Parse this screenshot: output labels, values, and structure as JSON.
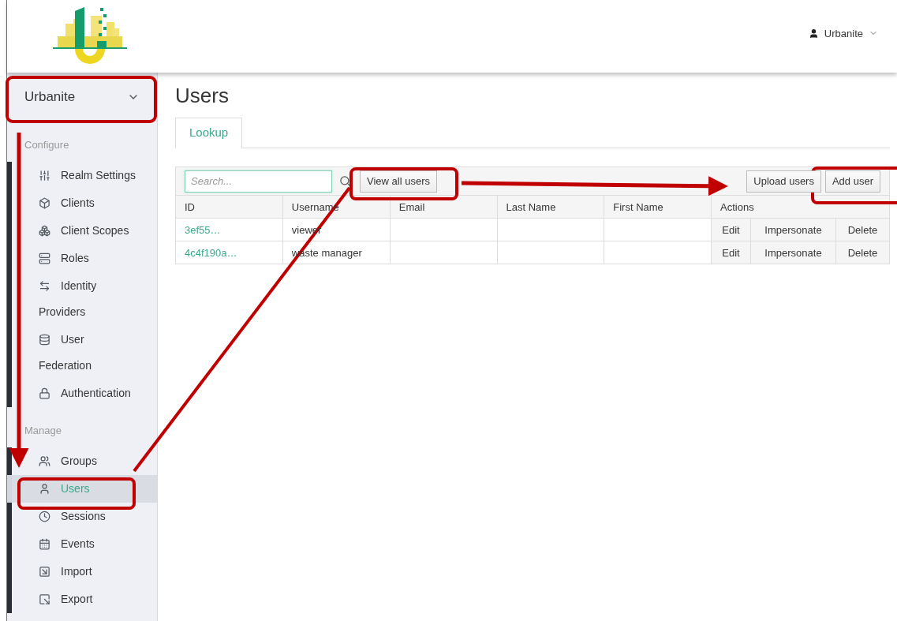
{
  "header": {
    "user": "Urbanite"
  },
  "sidebar": {
    "realm": "Urbanite",
    "sections": [
      {
        "title": "Configure",
        "items": [
          {
            "label": "Realm Settings",
            "selected": false
          },
          {
            "label": "Clients",
            "selected": false
          },
          {
            "label": "Client Scopes",
            "selected": false
          },
          {
            "label": "Roles",
            "selected": false
          },
          {
            "label": "Identity Providers",
            "selected": false
          },
          {
            "label": "User Federation",
            "selected": false
          },
          {
            "label": "Authentication",
            "selected": false
          }
        ]
      },
      {
        "title": "Manage",
        "items": [
          {
            "label": "Groups",
            "selected": false
          },
          {
            "label": "Users",
            "selected": true
          },
          {
            "label": "Sessions",
            "selected": false
          },
          {
            "label": "Events",
            "selected": false
          },
          {
            "label": "Import",
            "selected": false
          },
          {
            "label": "Export",
            "selected": false
          }
        ]
      }
    ]
  },
  "page": {
    "title": "Users",
    "tabs": [
      {
        "label": "Lookup",
        "selected": true
      }
    ]
  },
  "toolbar": {
    "search": {
      "placeholder": "Search..."
    },
    "left_buttons": [
      "View all users"
    ],
    "right_buttons": [
      "Upload users",
      "Add user"
    ]
  },
  "table": {
    "columns": [
      "ID",
      "Username",
      "Email",
      "Last Name",
      "First Name",
      "Actions"
    ],
    "rows": [
      {
        "id": "3ef55…",
        "username": "viewer",
        "actions": [
          "Edit",
          "Impersonate",
          "Delete"
        ]
      },
      {
        "id": "4c4f190a…",
        "username": "waste manager",
        "actions": [
          "Edit",
          "Impersonate",
          "Delete"
        ]
      }
    ]
  }
}
